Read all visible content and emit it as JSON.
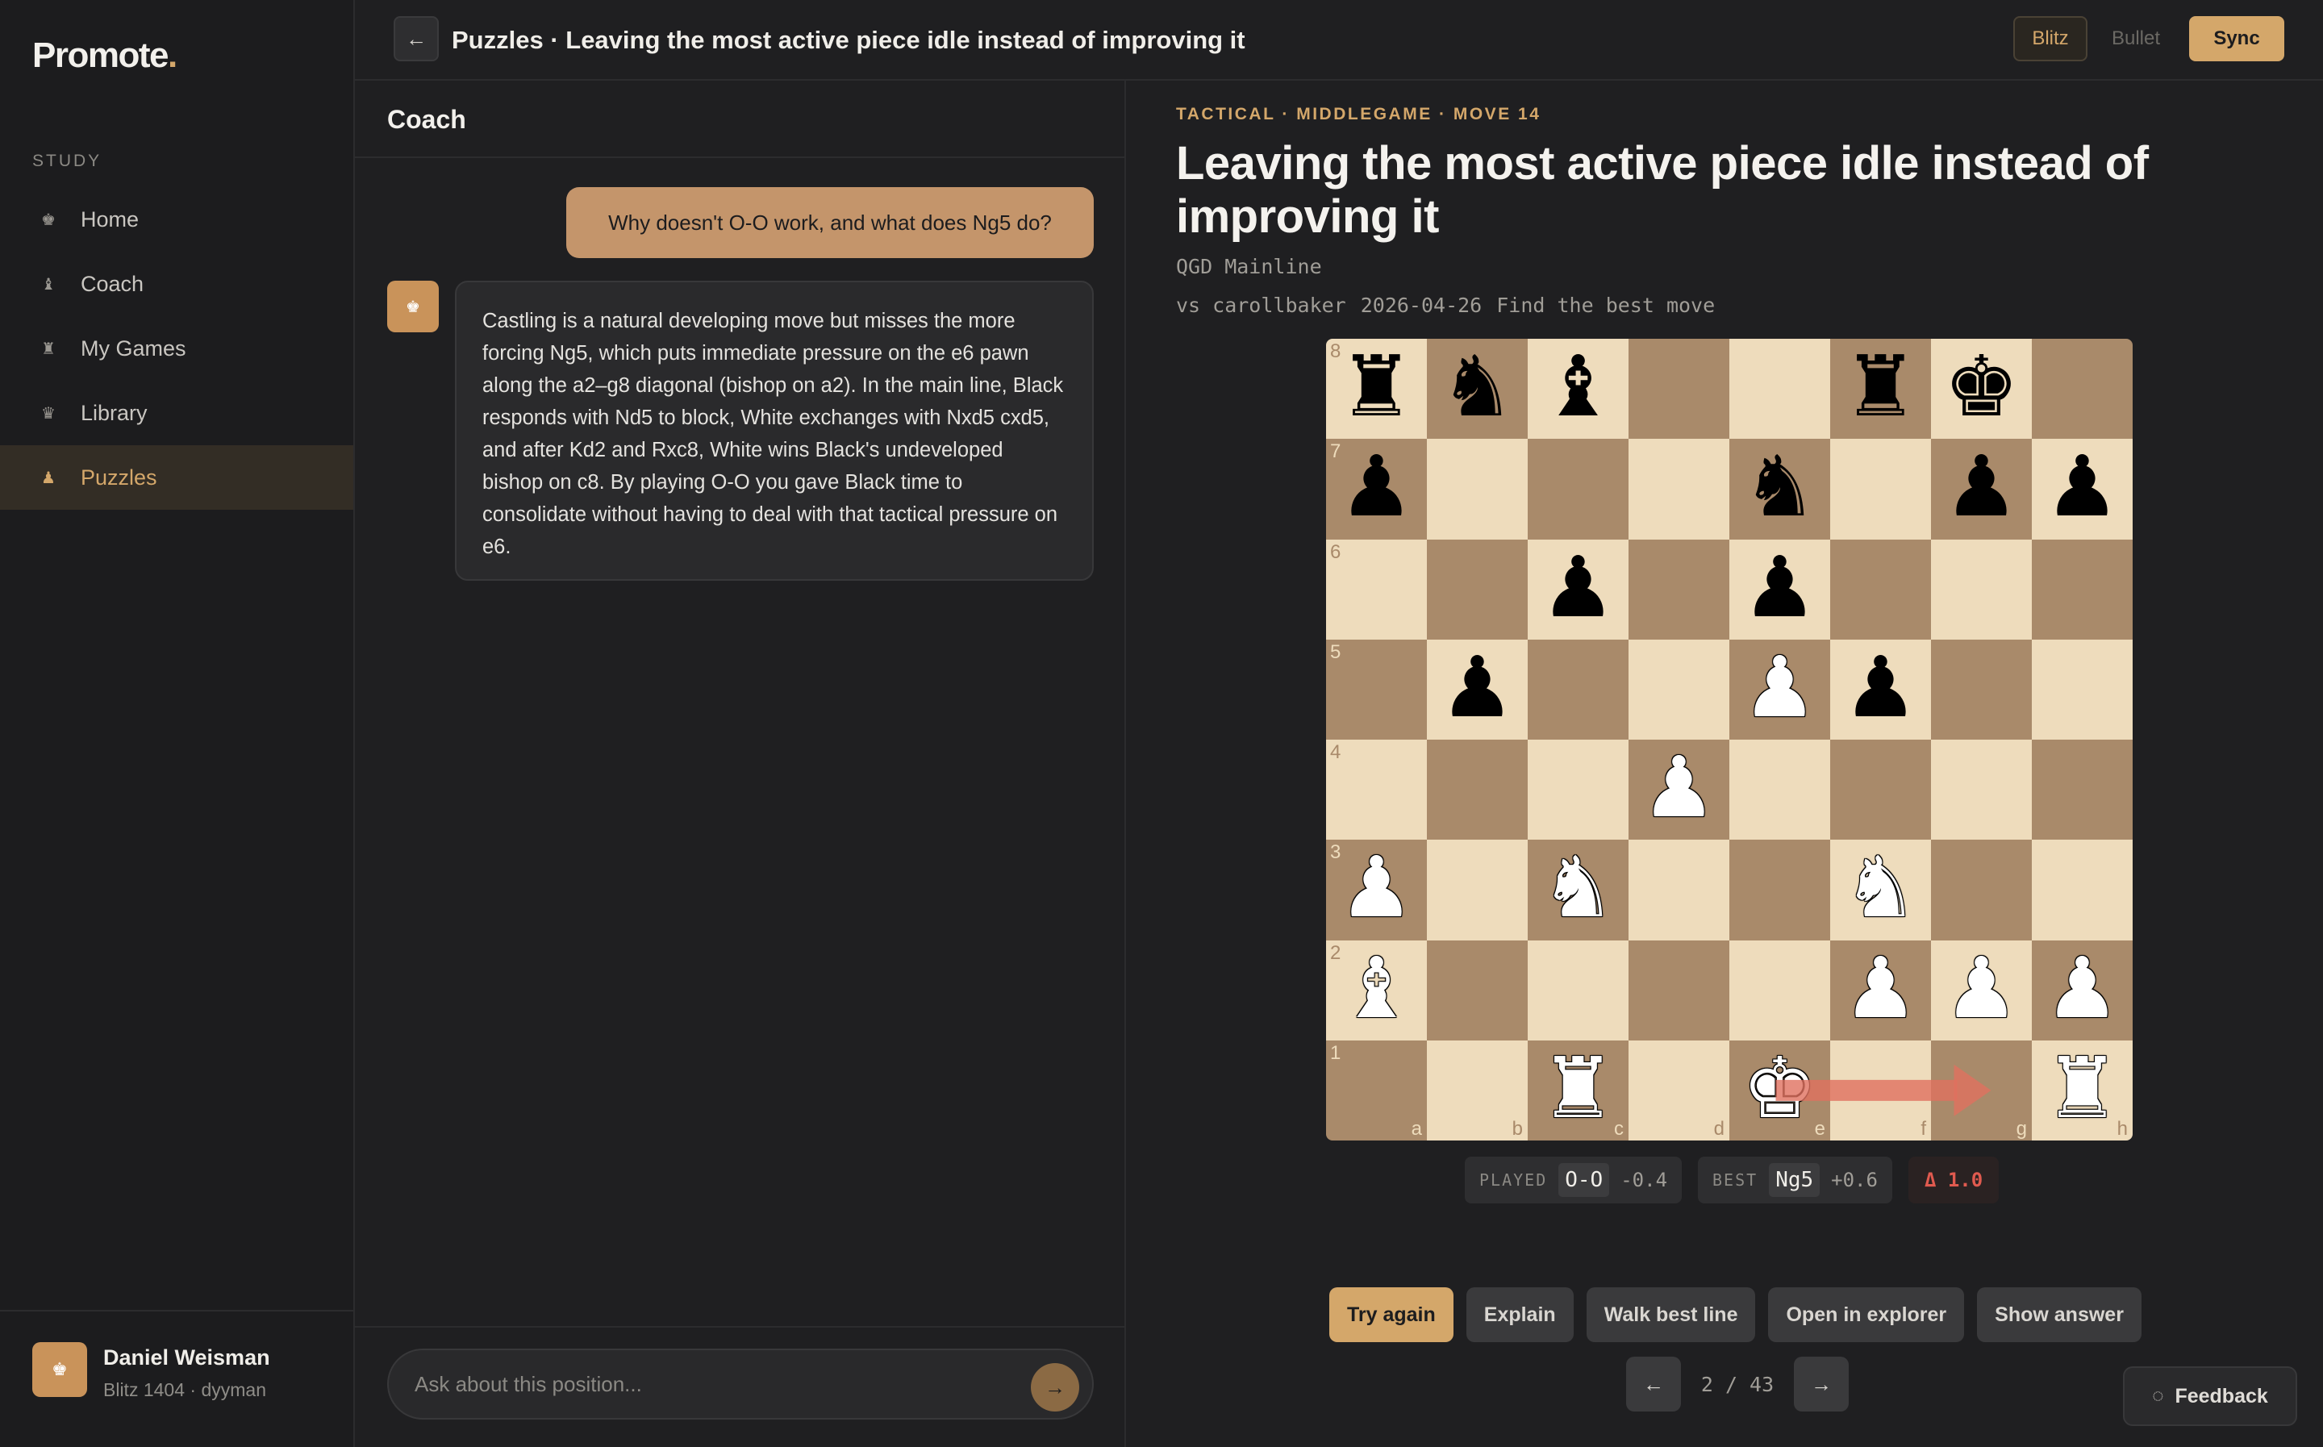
{
  "app": {
    "logo": "Promote",
    "logo_dot": "."
  },
  "sidebar": {
    "section": "STUDY",
    "items": [
      {
        "label": "Home",
        "icon": "♚"
      },
      {
        "label": "Coach",
        "icon": "♝"
      },
      {
        "label": "My Games",
        "icon": "♜"
      },
      {
        "label": "Library",
        "icon": "♛"
      },
      {
        "label": "Puzzles",
        "icon": "♟",
        "active": true
      }
    ],
    "user": {
      "name": "Daniel Weisman",
      "meta": "Blitz 1404 · dyyman",
      "avatar_icon": "♚"
    }
  },
  "topbar": {
    "back_icon": "←",
    "title": "Puzzles · Leaving the most active piece idle instead of improving it",
    "toggles": {
      "blitz": "Blitz",
      "bullet": "Bullet",
      "sync": "Sync"
    }
  },
  "coach": {
    "heading": "Coach",
    "user_message": "Why doesn't O-O work, and what does Ng5 do?",
    "assistant_icon": "♚",
    "assistant_message": "Castling is a natural developing move but misses the more forcing Ng5, which puts immediate pressure on the e6 pawn along the a2–g8 diagonal (bishop on a2). In the main line, Black responds with Nd5 to block, White exchanges with Nxd5 cxd5, and after Kd2 and Rxc8, White wins Black's undeveloped bishop on c8. By playing O-O you gave Black time to consolidate without having to deal with that tactical pressure on e6.",
    "input_placeholder": "Ask about this position...",
    "send_icon": "→"
  },
  "puzzle": {
    "kicker": "TACTICAL · MIDDLEGAME · MOVE 14",
    "title": "Leaving the most active piece idle instead of improving it",
    "opening": "QGD Mainline",
    "opponent": "vs carollbaker",
    "date": "2026-04-26",
    "task": "Find the best move",
    "board": {
      "rows": [
        [
          "br",
          "bn",
          "bb",
          "",
          "",
          "br",
          "bk",
          ""
        ],
        [
          "bp",
          "",
          "",
          "",
          "bn",
          "",
          "bp",
          "bp"
        ],
        [
          "",
          "",
          "bp",
          "",
          "bp",
          "",
          "",
          ""
        ],
        [
          "",
          "bp",
          "",
          "",
          "wp",
          "bp",
          "",
          ""
        ],
        [
          "",
          "",
          "",
          "wp",
          "",
          "",
          "",
          ""
        ],
        [
          "wp",
          "",
          "wn",
          "",
          "",
          "wn",
          "",
          ""
        ],
        [
          "wb",
          "",
          "",
          "",
          "",
          "wp",
          "wp",
          "wp"
        ],
        [
          "",
          "",
          "wr",
          "",
          "wk",
          "",
          "",
          "wr"
        ]
      ],
      "ranks": [
        "8",
        "7",
        "6",
        "5",
        "4",
        "3",
        "2",
        "1"
      ],
      "files": [
        "a",
        "b",
        "c",
        "d",
        "e",
        "f",
        "g",
        "h"
      ],
      "arrow": {
        "from": "e1",
        "to": "g1",
        "color": "#e0705f"
      }
    },
    "played": {
      "label": "PLAYED",
      "move": "O-O",
      "eval": "-0.4"
    },
    "best": {
      "label": "BEST",
      "move": "Ng5",
      "eval": "+0.6"
    },
    "delta": "Δ 1.0",
    "actions": {
      "try_again": "Try again",
      "explain": "Explain",
      "walk": "Walk best line",
      "explorer": "Open in explorer",
      "answer": "Show answer"
    },
    "pager": {
      "prev_icon": "←",
      "next_icon": "→",
      "text": "2 / 43"
    }
  },
  "feedback": {
    "icon": "◌",
    "label": "Feedback"
  },
  "colors": {
    "accent": "#d4a76a",
    "light_square": "#eedcbc",
    "dark_square": "#a98a6a",
    "delta": "#e05a4f"
  }
}
